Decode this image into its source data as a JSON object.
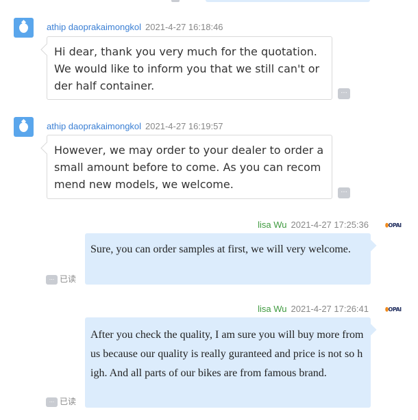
{
  "more_label": "...",
  "logo_text": "OPAI",
  "colors": {
    "self_bubble": "#dcecfc",
    "other_name": "#3a7fd4",
    "self_name": "#3f9a3f",
    "avatar": "#5aa6ec"
  },
  "messages": [
    {
      "sender": "athip daoprakaimongkol",
      "time": "2021-4-27 16:18:46",
      "text": "Hi dear, thank you very much for the quotation. We would like to inform you that we still can't order half container."
    },
    {
      "sender": "athip daoprakaimongkol",
      "time": "2021-4-27 16:19:57",
      "text": "However, we may order to your dealer to order a small amount before to come. As you can recommend new models, we welcome."
    },
    {
      "sender": "lisa Wu",
      "time": "2021-4-27 17:25:36",
      "text": "Sure, you can order samples at first, we will very welcome.",
      "status": "已读"
    },
    {
      "sender": "lisa Wu",
      "time": "2021-4-27 17:26:41",
      "text": "After you check the quality, I am sure you will buy more from us because our quality is really guranteed and price is not so high. And all parts of our bikes are from famous brand.",
      "status": "已读"
    }
  ]
}
